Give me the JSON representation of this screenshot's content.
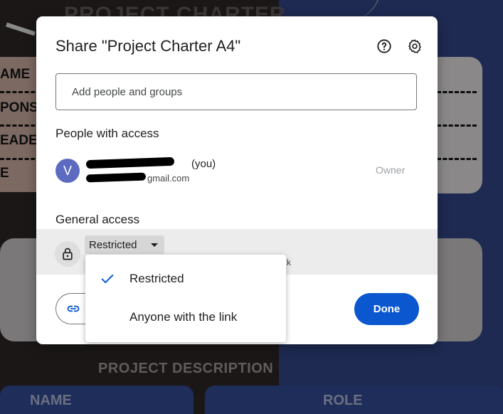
{
  "background": {
    "doc_title": "PROJECT CHARTER",
    "left_labels": [
      "AME",
      "PONS",
      "EADE",
      "E"
    ],
    "section_heading": "PROJECT DESCRIPTION",
    "col_name": "NAME",
    "col_role": "ROLE"
  },
  "dialog": {
    "title": "Share \"Project Charter A4\"",
    "help_icon": "help-circle-icon",
    "settings_icon": "gear-icon",
    "add_people_placeholder": "Add people and groups",
    "people_heading": "People with access",
    "person": {
      "avatar_letter": "V",
      "name_suffix": "(you)",
      "email_suffix": "gmail.com",
      "role": "Owner"
    },
    "general_access_heading": "General access",
    "access_level": "Restricted",
    "access_subtext": "k",
    "copy_link_icon": "link-icon",
    "done_label": "Done"
  },
  "access_menu": {
    "options": [
      {
        "label": "Restricted",
        "selected": true
      },
      {
        "label": "Anyone with the link",
        "selected": false
      }
    ]
  },
  "colors": {
    "accent": "#0b57d0",
    "avatar": "#5c6bc0",
    "check": "#0b57d0"
  }
}
